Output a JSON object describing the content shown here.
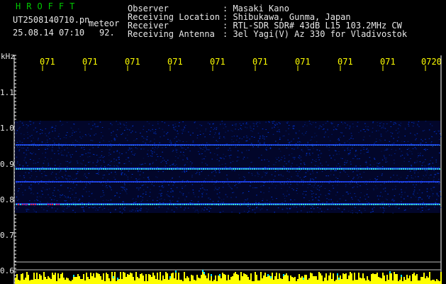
{
  "header": {
    "brand": "HROFFT",
    "filename": "UT2508140710.pn",
    "suffix": "meteor",
    "datetime": "25.08.14 07:10",
    "count": "92."
  },
  "info": {
    "rows": [
      {
        "label": "Observer",
        "value": ": Masaki Kano"
      },
      {
        "label": "Receiving Location",
        "value": ": Shibukawa, Gunma, Japan"
      },
      {
        "label": "Receiver",
        "value": ": RTL-SDR SDR# 43dB L15 103.2MHz CW"
      },
      {
        "label": "Receiving Antenna",
        "value": ": 3el Yagi(V) Az 330 for Vladivostok"
      }
    ]
  },
  "axis": {
    "unit": "kHz",
    "ticks": [
      "1.1",
      "1.0",
      "0.9",
      "0.8",
      "0.7",
      "0.6"
    ]
  },
  "time_labels": [
    "071",
    "071",
    "071",
    "071",
    "071",
    "071",
    "071",
    "071",
    "071",
    "0720"
  ],
  "colors": {
    "brand": "#00c800",
    "text": "#e8e8e8",
    "time_labels": "#ffff00",
    "noise_band": "#0a1a8c",
    "echo_line": "#39ffc0",
    "echo_hot": "#ff3030",
    "bottom_bars": "#ffff00",
    "bottom_cyan": "#00e0ff"
  }
}
